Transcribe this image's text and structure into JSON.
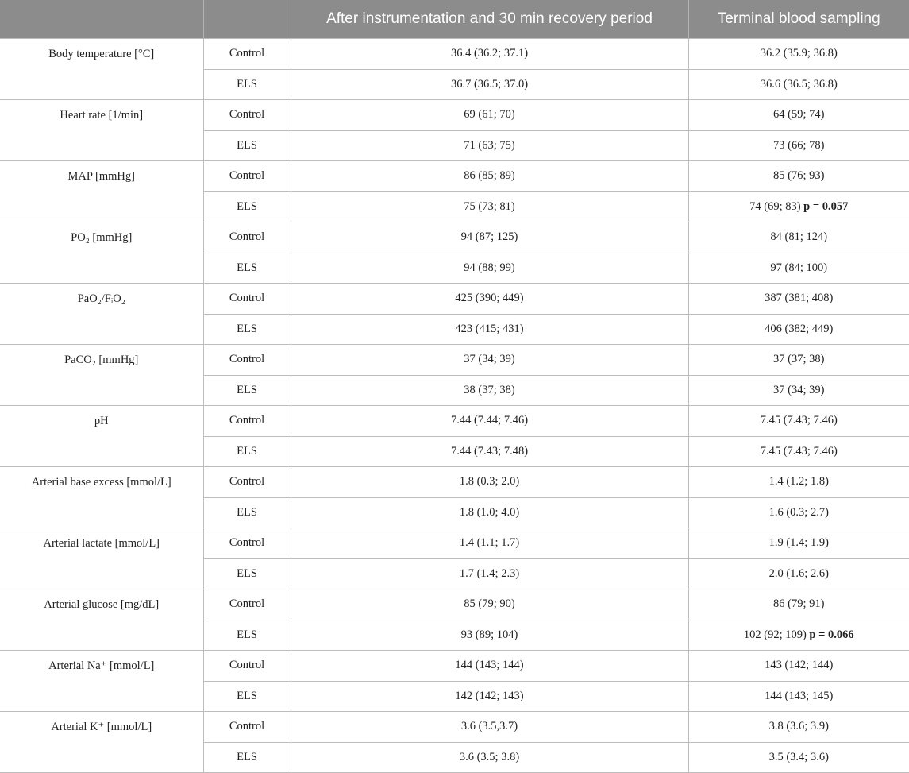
{
  "header": {
    "col1": "",
    "col2": "",
    "col3": "After instrumentation and 30 min recovery period",
    "col4": "Terminal blood sampling"
  },
  "rows": [
    {
      "param": "Body temperature [°C]",
      "control": {
        "label": "Control",
        "a": "36.4 (36.2; 37.1)",
        "b": "36.2 (35.9; 36.8)"
      },
      "els": {
        "label": "ELS",
        "a": "36.7 (36.5; 37.0)",
        "b": "36.6 (36.5; 36.8)"
      }
    },
    {
      "param": "Heart rate [1/min]",
      "control": {
        "label": "Control",
        "a": "69 (61; 70)",
        "b": "64 (59; 74)"
      },
      "els": {
        "label": "ELS",
        "a": "71 (63; 75)",
        "b": "73 (66; 78)"
      }
    },
    {
      "param": "MAP [mmHg]",
      "control": {
        "label": "Control",
        "a": "86 (85; 89)",
        "b": "85 (76; 93)"
      },
      "els": {
        "label": "ELS",
        "a": "75 (73; 81)",
        "b": "74 (69; 83)",
        "p": "p = 0.057"
      }
    },
    {
      "param": "PO₂ [mmHg]",
      "control": {
        "label": "Control",
        "a": "94 (87; 125)",
        "b": "84 (81; 124)"
      },
      "els": {
        "label": "ELS",
        "a": "94 (88; 99)",
        "b": "97 (84; 100)"
      }
    },
    {
      "param": "PaO₂/FᵢO₂",
      "control": {
        "label": "Control",
        "a": "425 (390; 449)",
        "b": "387 (381; 408)"
      },
      "els": {
        "label": "ELS",
        "a": "423 (415; 431)",
        "b": "406 (382; 449)"
      }
    },
    {
      "param": "PaCO₂ [mmHg]",
      "control": {
        "label": "Control",
        "a": "37 (34; 39)",
        "b": "37 (37; 38)"
      },
      "els": {
        "label": "ELS",
        "a": "38 (37; 38)",
        "b": "37 (34; 39)"
      }
    },
    {
      "param": "pH",
      "control": {
        "label": "Control",
        "a": "7.44 (7.44; 7.46)",
        "b": "7.45 (7.43; 7.46)"
      },
      "els": {
        "label": "ELS",
        "a": "7.44 (7.43; 7.48)",
        "b": "7.45 (7.43; 7.46)"
      }
    },
    {
      "param": "Arterial base excess [mmol/L]",
      "control": {
        "label": "Control",
        "a": "1.8 (0.3; 2.0)",
        "b": "1.4 (1.2; 1.8)"
      },
      "els": {
        "label": "ELS",
        "a": "1.8 (1.0; 4.0)",
        "b": "1.6 (0.3; 2.7)"
      }
    },
    {
      "param": "Arterial lactate [mmol/L]",
      "control": {
        "label": "Control",
        "a": "1.4 (1.1; 1.7)",
        "b": "1.9 (1.4; 1.9)"
      },
      "els": {
        "label": "ELS",
        "a": "1.7 (1.4; 2.3)",
        "b": "2.0 (1.6; 2.6)"
      }
    },
    {
      "param": "Arterial glucose [mg/dL]",
      "control": {
        "label": "Control",
        "a": "85 (79; 90)",
        "b": "86 (79; 91)"
      },
      "els": {
        "label": "ELS",
        "a": "93 (89; 104)",
        "b": "102 (92; 109)",
        "p": "p = 0.066"
      }
    },
    {
      "param": "Arterial Na⁺ [mmol/L]",
      "control": {
        "label": "Control",
        "a": "144 (143; 144)",
        "b": "143 (142; 144)"
      },
      "els": {
        "label": "ELS",
        "a": "142 (142; 143)",
        "b": "144 (143; 145)"
      }
    },
    {
      "param": "Arterial K⁺ [mmol/L]",
      "control": {
        "label": "Control",
        "a": "3.6 (3.5,3.7)",
        "b": "3.8 (3.6; 3.9)"
      },
      "els": {
        "label": "ELS",
        "a": "3.6 (3.5; 3.8)",
        "b": "3.5 (3.4; 3.6)"
      }
    }
  ]
}
